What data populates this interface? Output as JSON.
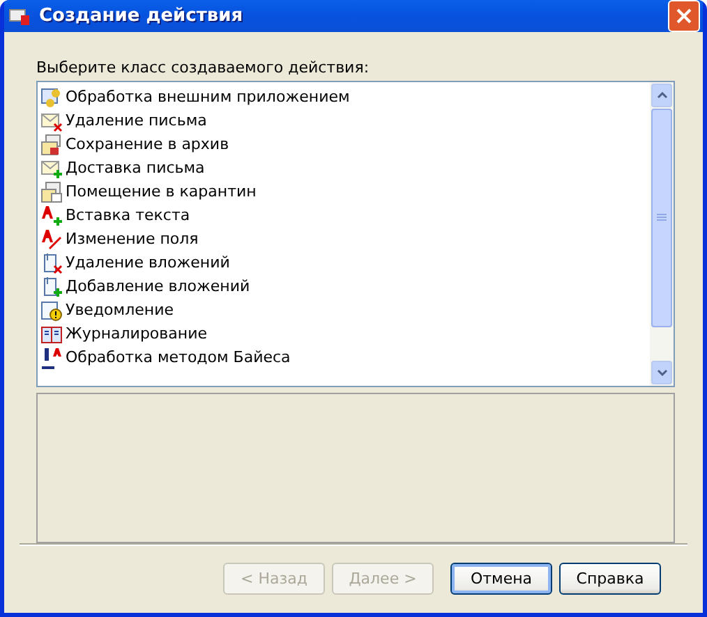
{
  "window": {
    "title": "Создание действия"
  },
  "prompt": "Выберите класс создаваемого действия:",
  "actions": [
    {
      "label": "Обработка внешним приложением",
      "kind": "app"
    },
    {
      "label": "Удаление письма",
      "kind": "mail-delete"
    },
    {
      "label": "Сохранение в архив",
      "kind": "archive"
    },
    {
      "label": "Доставка письма",
      "kind": "mail-add"
    },
    {
      "label": "Помещение в карантин",
      "kind": "quarantine"
    },
    {
      "label": "Вставка текста",
      "kind": "text-add"
    },
    {
      "label": "Изменение поля",
      "kind": "text-edit"
    },
    {
      "label": "Удаление вложений",
      "kind": "attach-delete"
    },
    {
      "label": "Добавление вложений",
      "kind": "attach-add"
    },
    {
      "label": "Уведомление",
      "kind": "notify"
    },
    {
      "label": "Журналирование",
      "kind": "journal"
    },
    {
      "label": "Обработка методом Байеса",
      "kind": "bayes"
    }
  ],
  "buttons": [
    {
      "label": "< Назад",
      "disabled": true,
      "focused": false
    },
    {
      "label": "Далее >",
      "disabled": true,
      "focused": false
    },
    {
      "label": "Отмена",
      "disabled": false,
      "focused": true
    },
    {
      "label": "Справка",
      "disabled": false,
      "focused": false
    }
  ]
}
